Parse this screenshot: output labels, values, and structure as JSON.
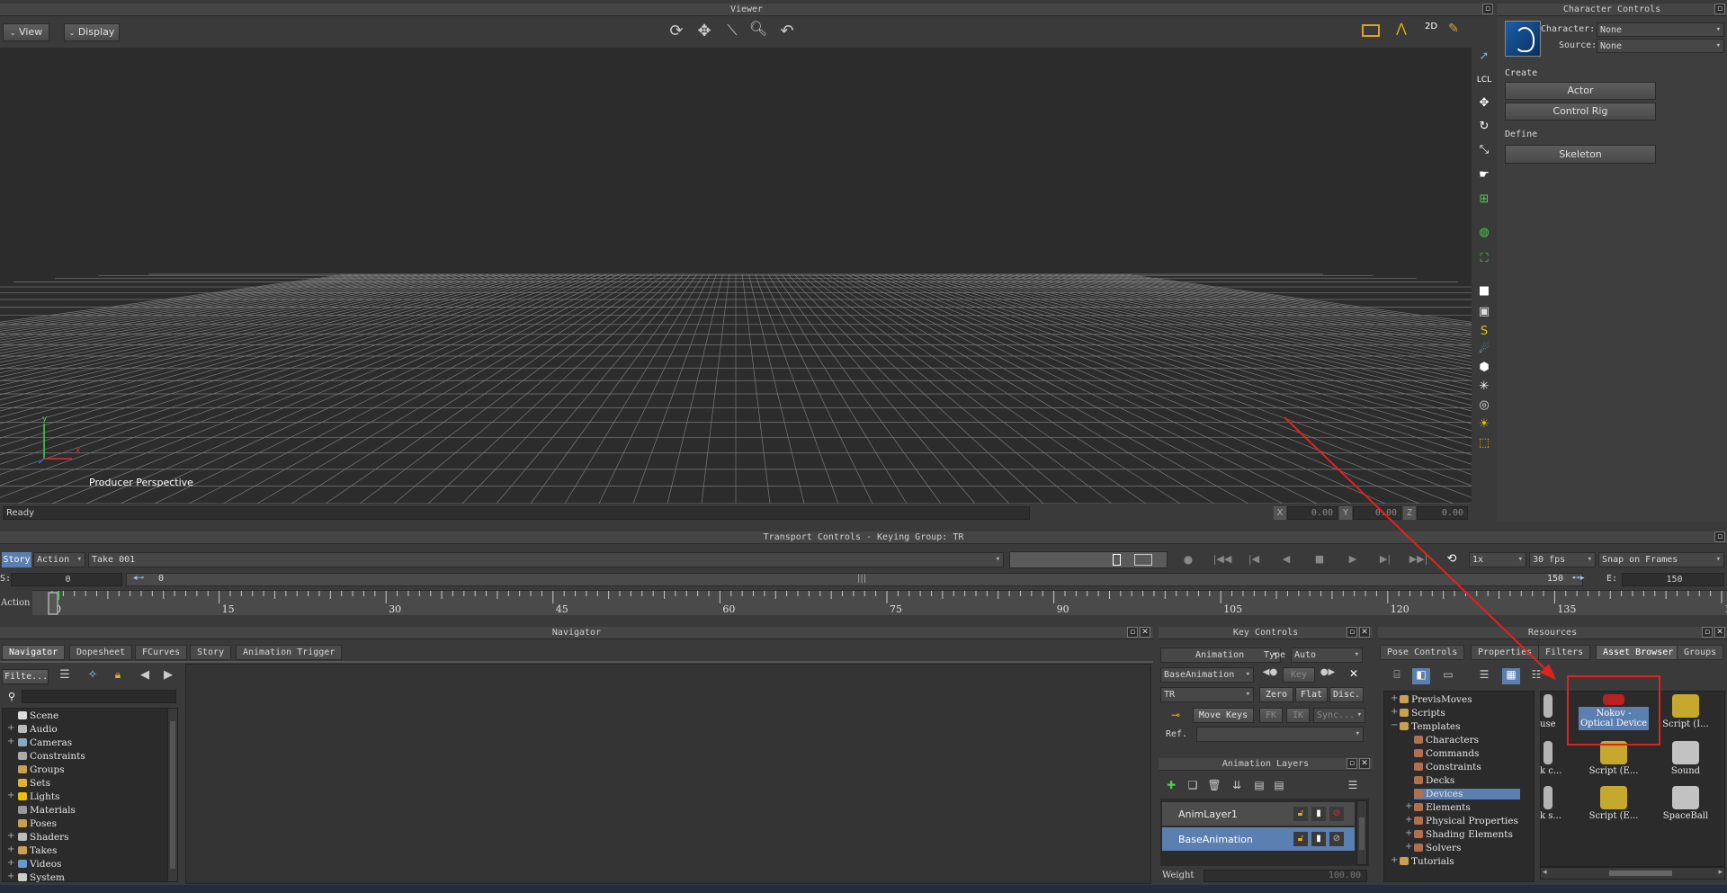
{
  "viewer": {
    "title": "Viewer",
    "menu_view": "View",
    "menu_display": "Display",
    "perspective_label": "Producer Perspective",
    "status": "Ready",
    "coord_x_label": "X",
    "coord_x": "0.00",
    "coord_y_label": "Y",
    "coord_y": "0.00",
    "coord_z_label": "Z",
    "coord_z": "0.00",
    "axis_x": "x",
    "axis_y": "y"
  },
  "character_controls": {
    "title": "Character Controls",
    "character_label": "Character:",
    "character_value": "None",
    "source_label": "Source:",
    "source_value": "None",
    "create_label": "Create",
    "actor_button": "Actor",
    "control_rig_button": "Control Rig",
    "define_label": "Define",
    "skeleton_button": "Skeleton"
  },
  "transport": {
    "title": "Transport Controls  -  Keying Group: TR",
    "story_btn": "Story",
    "action_dd": "Action",
    "take": "Take 001",
    "speed": "1x",
    "fps": "30 fps",
    "snap": "Snap on Frames",
    "start_label": "S:",
    "start_value": "0",
    "current": "0",
    "end_marker": "150",
    "end_label": "E:",
    "end_value": "150",
    "action_label": "Action",
    "ruler": [
      "0",
      "15",
      "30",
      "45",
      "60",
      "75",
      "90",
      "105",
      "120",
      "135",
      "150"
    ]
  },
  "navigator": {
    "title": "Navigator",
    "tabs": [
      "Navigator",
      "Dopesheet",
      "FCurves",
      "Story",
      "Animation Trigger"
    ],
    "filter": "Filte...",
    "tree": [
      "Scene",
      "Audio",
      "Cameras",
      "Constraints",
      "Groups",
      "Sets",
      "Lights",
      "Materials",
      "Poses",
      "Shaders",
      "Takes",
      "Videos",
      "System"
    ]
  },
  "key_controls": {
    "title": "Key Controls",
    "mode": "Animation",
    "type_label": "Type",
    "type_value": "Auto",
    "layer": "BaseAnimation",
    "key_btn": "Key",
    "group": "TR",
    "zero": "Zero",
    "flat": "Flat",
    "disc": "Disc.",
    "move_keys": "Move Keys",
    "fk": "FK",
    "ik": "IK",
    "sync": "Sync...",
    "ref_label": "Ref.",
    "layers_title": "Animation Layers",
    "layers": [
      "AnimLayer1",
      "BaseAnimation"
    ],
    "weight_label": "Weight",
    "weight_value": "100.00"
  },
  "resources": {
    "title": "Resources",
    "tabs": [
      "Pose Controls",
      "Properties",
      "Filters",
      "Asset Browser",
      "Groups"
    ],
    "tree": [
      {
        "label": "PrevisMoves",
        "indent": 0,
        "exp": "+"
      },
      {
        "label": "Scripts",
        "indent": 0,
        "exp": "+"
      },
      {
        "label": "Templates",
        "indent": 0,
        "exp": "−"
      },
      {
        "label": "Characters",
        "indent": 1,
        "exp": ""
      },
      {
        "label": "Commands",
        "indent": 1,
        "exp": ""
      },
      {
        "label": "Constraints",
        "indent": 1,
        "exp": ""
      },
      {
        "label": "Decks",
        "indent": 1,
        "exp": ""
      },
      {
        "label": "Devices",
        "indent": 1,
        "exp": ""
      },
      {
        "label": "Elements",
        "indent": 1,
        "exp": "+"
      },
      {
        "label": "Physical Properties",
        "indent": 1,
        "exp": "+"
      },
      {
        "label": "Shading Elements",
        "indent": 1,
        "exp": "+"
      },
      {
        "label": "Solvers",
        "indent": 1,
        "exp": "+"
      },
      {
        "label": "Tutorials",
        "indent": 0,
        "exp": "+"
      }
    ],
    "assets": [
      {
        "label": "use",
        "col": 0,
        "row": 0
      },
      {
        "label": "Nokov - Optical Device",
        "col": 1,
        "row": 0
      },
      {
        "label": "Script (I...",
        "col": 2,
        "row": 0
      },
      {
        "label": "k c...",
        "col": 0,
        "row": 1
      },
      {
        "label": "Script (E...",
        "col": 1,
        "row": 1
      },
      {
        "label": "Sound",
        "col": 2,
        "row": 1
      },
      {
        "label": "k s...",
        "col": 0,
        "row": 2
      },
      {
        "label": "Script (E...",
        "col": 1,
        "row": 2
      },
      {
        "label": "SpaceBall",
        "col": 2,
        "row": 2
      }
    ]
  },
  "colors": {
    "highlight": "#5b7fb0",
    "annotation": "#e0241b"
  }
}
